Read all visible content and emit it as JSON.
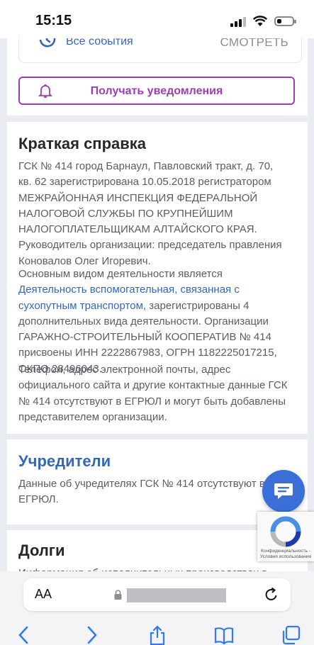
{
  "status_bar": {
    "time": "15:15"
  },
  "events": {
    "label": "Все события",
    "more": "СМОТРЕТЬ"
  },
  "notify_button": {
    "label": "Получать уведомления"
  },
  "summary": {
    "title": "Краткая справка",
    "p1": "ГСК № 414 город Барнаул, Павловский тракт, д. 70, кв. 62 зарегистрирована 10.05.2018 регистратором МЕЖРАЙОННАЯ ИНСПЕКЦИЯ ФЕДЕРАЛЬНОЙ НАЛОГОВОЙ СЛУЖБЫ ПО КРУПНЕЙШИМ НАЛОГОПЛАТЕЛЬЩИКАМ АЛТАЙСКОГО КРАЯ. Руководитель организации: председатель правления Коновалов Олег Игоревич.",
    "p2_before": "Основным видом деятельности является ",
    "p2_link": "Деятельность вспомогательная, связанная с сухопутным транспортом",
    "p2_after": ", зарегистрированы 4 дополнительных вида деятельности. Организации ГАРАЖНО-СТРОИТЕЛЬНЫЙ КООПЕРАТИВ № 414 присвоены ИНН 2222867983, ОГРН 1182225017215, ОКПО 28496043.",
    "p3": "Телефон, адрес электронной почты, адрес официального сайта и другие контактные данные ГСК № 414 отсутствуют в ЕГРЮЛ и могут быть добавлены представителем организации."
  },
  "founders": {
    "title": "Учредители",
    "text": "Данные об учредителях ГСК № 414 отсутствуют в ЕГРЮЛ."
  },
  "debts": {
    "title": "Долги",
    "text": "Информация об исполнительных производствах в"
  },
  "recaptcha": {
    "text": "Конфиденциальность - Условия использования"
  },
  "browser": {
    "text_size": "AA"
  }
}
